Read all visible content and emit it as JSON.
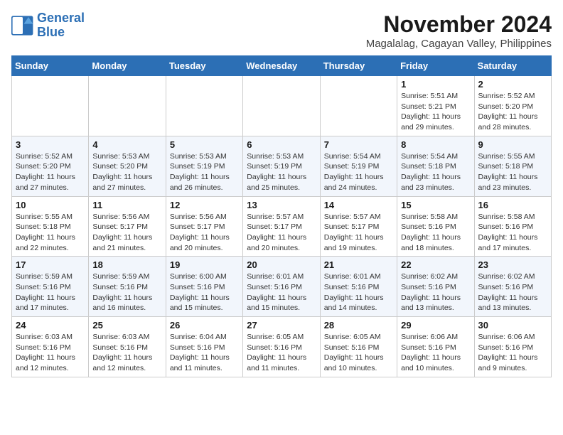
{
  "logo": {
    "line1": "General",
    "line2": "Blue"
  },
  "title": "November 2024",
  "location": "Magalalag, Cagayan Valley, Philippines",
  "weekdays": [
    "Sunday",
    "Monday",
    "Tuesday",
    "Wednesday",
    "Thursday",
    "Friday",
    "Saturday"
  ],
  "weeks": [
    [
      {
        "day": "",
        "info": ""
      },
      {
        "day": "",
        "info": ""
      },
      {
        "day": "",
        "info": ""
      },
      {
        "day": "",
        "info": ""
      },
      {
        "day": "",
        "info": ""
      },
      {
        "day": "1",
        "info": "Sunrise: 5:51 AM\nSunset: 5:21 PM\nDaylight: 11 hours and 29 minutes."
      },
      {
        "day": "2",
        "info": "Sunrise: 5:52 AM\nSunset: 5:20 PM\nDaylight: 11 hours and 28 minutes."
      }
    ],
    [
      {
        "day": "3",
        "info": "Sunrise: 5:52 AM\nSunset: 5:20 PM\nDaylight: 11 hours and 27 minutes."
      },
      {
        "day": "4",
        "info": "Sunrise: 5:53 AM\nSunset: 5:20 PM\nDaylight: 11 hours and 27 minutes."
      },
      {
        "day": "5",
        "info": "Sunrise: 5:53 AM\nSunset: 5:19 PM\nDaylight: 11 hours and 26 minutes."
      },
      {
        "day": "6",
        "info": "Sunrise: 5:53 AM\nSunset: 5:19 PM\nDaylight: 11 hours and 25 minutes."
      },
      {
        "day": "7",
        "info": "Sunrise: 5:54 AM\nSunset: 5:19 PM\nDaylight: 11 hours and 24 minutes."
      },
      {
        "day": "8",
        "info": "Sunrise: 5:54 AM\nSunset: 5:18 PM\nDaylight: 11 hours and 23 minutes."
      },
      {
        "day": "9",
        "info": "Sunrise: 5:55 AM\nSunset: 5:18 PM\nDaylight: 11 hours and 23 minutes."
      }
    ],
    [
      {
        "day": "10",
        "info": "Sunrise: 5:55 AM\nSunset: 5:18 PM\nDaylight: 11 hours and 22 minutes."
      },
      {
        "day": "11",
        "info": "Sunrise: 5:56 AM\nSunset: 5:17 PM\nDaylight: 11 hours and 21 minutes."
      },
      {
        "day": "12",
        "info": "Sunrise: 5:56 AM\nSunset: 5:17 PM\nDaylight: 11 hours and 20 minutes."
      },
      {
        "day": "13",
        "info": "Sunrise: 5:57 AM\nSunset: 5:17 PM\nDaylight: 11 hours and 20 minutes."
      },
      {
        "day": "14",
        "info": "Sunrise: 5:57 AM\nSunset: 5:17 PM\nDaylight: 11 hours and 19 minutes."
      },
      {
        "day": "15",
        "info": "Sunrise: 5:58 AM\nSunset: 5:16 PM\nDaylight: 11 hours and 18 minutes."
      },
      {
        "day": "16",
        "info": "Sunrise: 5:58 AM\nSunset: 5:16 PM\nDaylight: 11 hours and 17 minutes."
      }
    ],
    [
      {
        "day": "17",
        "info": "Sunrise: 5:59 AM\nSunset: 5:16 PM\nDaylight: 11 hours and 17 minutes."
      },
      {
        "day": "18",
        "info": "Sunrise: 5:59 AM\nSunset: 5:16 PM\nDaylight: 11 hours and 16 minutes."
      },
      {
        "day": "19",
        "info": "Sunrise: 6:00 AM\nSunset: 5:16 PM\nDaylight: 11 hours and 15 minutes."
      },
      {
        "day": "20",
        "info": "Sunrise: 6:01 AM\nSunset: 5:16 PM\nDaylight: 11 hours and 15 minutes."
      },
      {
        "day": "21",
        "info": "Sunrise: 6:01 AM\nSunset: 5:16 PM\nDaylight: 11 hours and 14 minutes."
      },
      {
        "day": "22",
        "info": "Sunrise: 6:02 AM\nSunset: 5:16 PM\nDaylight: 11 hours and 13 minutes."
      },
      {
        "day": "23",
        "info": "Sunrise: 6:02 AM\nSunset: 5:16 PM\nDaylight: 11 hours and 13 minutes."
      }
    ],
    [
      {
        "day": "24",
        "info": "Sunrise: 6:03 AM\nSunset: 5:16 PM\nDaylight: 11 hours and 12 minutes."
      },
      {
        "day": "25",
        "info": "Sunrise: 6:03 AM\nSunset: 5:16 PM\nDaylight: 11 hours and 12 minutes."
      },
      {
        "day": "26",
        "info": "Sunrise: 6:04 AM\nSunset: 5:16 PM\nDaylight: 11 hours and 11 minutes."
      },
      {
        "day": "27",
        "info": "Sunrise: 6:05 AM\nSunset: 5:16 PM\nDaylight: 11 hours and 11 minutes."
      },
      {
        "day": "28",
        "info": "Sunrise: 6:05 AM\nSunset: 5:16 PM\nDaylight: 11 hours and 10 minutes."
      },
      {
        "day": "29",
        "info": "Sunrise: 6:06 AM\nSunset: 5:16 PM\nDaylight: 11 hours and 10 minutes."
      },
      {
        "day": "30",
        "info": "Sunrise: 6:06 AM\nSunset: 5:16 PM\nDaylight: 11 hours and 9 minutes."
      }
    ]
  ]
}
